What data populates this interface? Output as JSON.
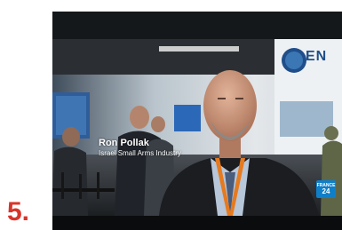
{
  "list_number": "5.",
  "video": {
    "caption_name": "Ron Pollak",
    "caption_title": "Israel Small Arms Industry",
    "booth_sign": "EN",
    "channel_logo": {
      "top": "FRANCE",
      "number": "24",
      "icon": "france24-logo"
    }
  },
  "colors": {
    "list_number": "#d8342a",
    "letterbox": "#15181b",
    "channel_logo": "#0f7fc9"
  }
}
